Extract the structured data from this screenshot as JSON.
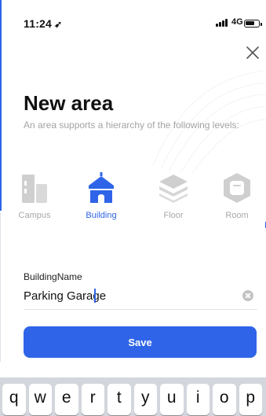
{
  "status_bar": {
    "time": "11:24",
    "location_arrow": "➤",
    "network": "4G"
  },
  "header": {
    "title": "New area",
    "subtitle": "An area supports a hierarchy of the following levels:"
  },
  "levels": [
    {
      "label": "Campus",
      "icon": "campus-icon",
      "active": false
    },
    {
      "label": "Building",
      "icon": "building-icon",
      "active": true
    },
    {
      "label": "Floor",
      "icon": "floor-icon",
      "active": false
    },
    {
      "label": "Room",
      "icon": "room-icon",
      "active": false
    }
  ],
  "form": {
    "field_label": "BuildingName",
    "field_value": "Parking Garage"
  },
  "actions": {
    "save_label": "Save"
  },
  "keyboard": {
    "top_row": [
      "q",
      "w",
      "e",
      "r",
      "t",
      "y",
      "u",
      "i",
      "o",
      "p"
    ]
  },
  "colors": {
    "accent": "#2f64e8",
    "inactive": "#c9c9c9",
    "subtitle": "#a3a3a3"
  }
}
